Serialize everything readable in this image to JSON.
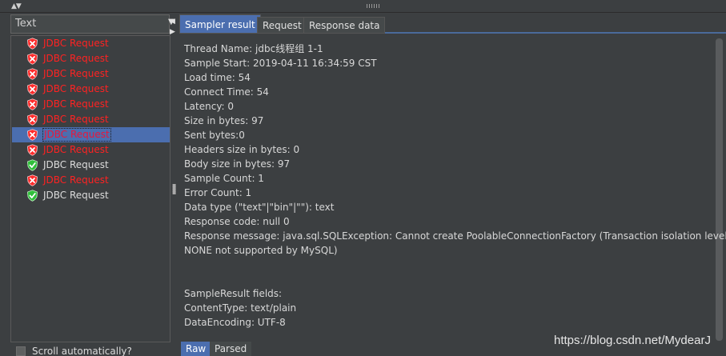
{
  "left_panel": {
    "view_combo_value": "Text",
    "scroll_auto_label": "Scroll automatically?",
    "results": [
      {
        "label": "JDBC Request",
        "status": "error"
      },
      {
        "label": "JDBC Request",
        "status": "error"
      },
      {
        "label": "JDBC Request",
        "status": "error"
      },
      {
        "label": "JDBC Request",
        "status": "error"
      },
      {
        "label": "JDBC Request",
        "status": "error"
      },
      {
        "label": "JDBC Request",
        "status": "error"
      },
      {
        "label": "JDBC Request",
        "status": "error",
        "selected": true
      },
      {
        "label": "JDBC Request",
        "status": "error"
      },
      {
        "label": "JDBC Request",
        "status": "success"
      },
      {
        "label": "JDBC Request",
        "status": "error"
      },
      {
        "label": "JDBC Request",
        "status": "success"
      }
    ]
  },
  "right_panel": {
    "tabs": [
      "Sampler result",
      "Request",
      "Response data"
    ],
    "active_tab": "Sampler result",
    "lines": [
      "Thread Name: jdbc线程组 1-1",
      "Sample Start: 2019-04-11 16:34:59 CST",
      "Load time: 54",
      "Connect Time: 54",
      "Latency: 0",
      "Size in bytes: 97",
      "Sent bytes:0",
      "Headers size in bytes: 0",
      "Body size in bytes: 97",
      "Sample Count: 1",
      "Error Count: 1",
      "Data type (\"text\"|\"bin\"|\"\"): text",
      "Response code: null 0",
      "Response message: java.sql.SQLException: Cannot create PoolableConnectionFactory (Transaction isolation level",
      "NONE not supported by MySQL)",
      "",
      "",
      "SampleResult fields:",
      "ContentType: text/plain",
      "DataEncoding: UTF-8"
    ],
    "bottom_tabs": [
      "Raw",
      "Parsed"
    ],
    "active_bottom_tab": "Raw"
  },
  "watermark": "https://blog.csdn.net/MydearJ",
  "colors": {
    "error": "#ff2222",
    "success": "#3fbf3f",
    "selection": "#4b6eaf",
    "background": "#3c3f41"
  }
}
